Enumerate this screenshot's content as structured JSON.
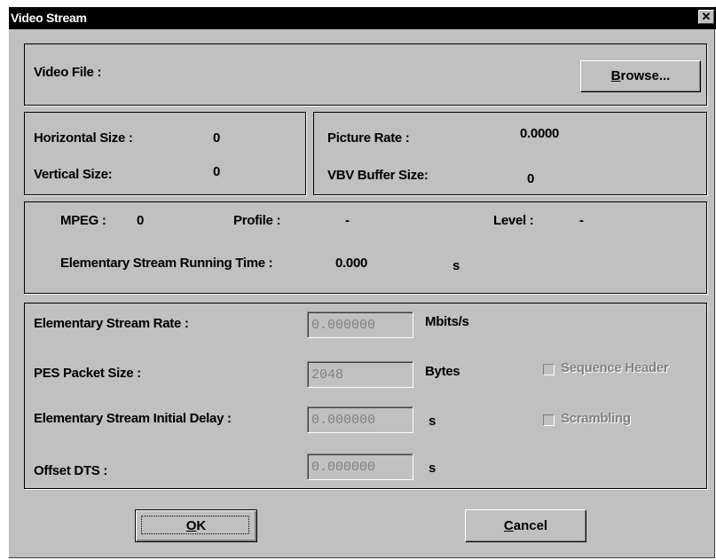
{
  "window": {
    "title": "Video Stream",
    "close_glyph": "✕"
  },
  "file": {
    "label": "Video File :",
    "browse_pre": "",
    "browse_mnemonic": "B",
    "browse_rest": "rowse..."
  },
  "size": {
    "horizontal_label": "Horizontal Size :",
    "horizontal_value": "0",
    "vertical_label": "Vertical Size:",
    "vertical_value": "0"
  },
  "rate": {
    "picture_rate_label": "Picture Rate :",
    "picture_rate_value": "0.0000",
    "vbv_label": "VBV Buffer Size:",
    "vbv_value": "0"
  },
  "mpeg": {
    "mpeg_label": "MPEG :",
    "mpeg_value": "0",
    "profile_label": "Profile :",
    "profile_value": "-",
    "level_label": "Level :",
    "level_value": "-",
    "running_time_label": "Elementary Stream Running Time :",
    "running_time_value": "0.000",
    "running_time_unit": "s"
  },
  "stream": {
    "rate_label": "Elementary Stream Rate :",
    "rate_value": "0.000000",
    "rate_unit": "Mbits/s",
    "pes_label": "PES Packet Size :",
    "pes_value": "2048",
    "pes_unit": "Bytes",
    "delay_label": "Elementary Stream Initial Delay :",
    "delay_value": "0.000000",
    "delay_unit": "s",
    "offset_label": "Offset DTS :",
    "offset_value": "0.000000",
    "offset_unit": "s",
    "sequence_header_label": "Sequence Header",
    "sequence_header_checked": false,
    "scrambling_label": "Scrambling",
    "scrambling_checked": false
  },
  "buttons": {
    "ok_mnemonic": "O",
    "ok_rest": "K",
    "cancel_mnemonic": "C",
    "cancel_rest": "ancel"
  }
}
